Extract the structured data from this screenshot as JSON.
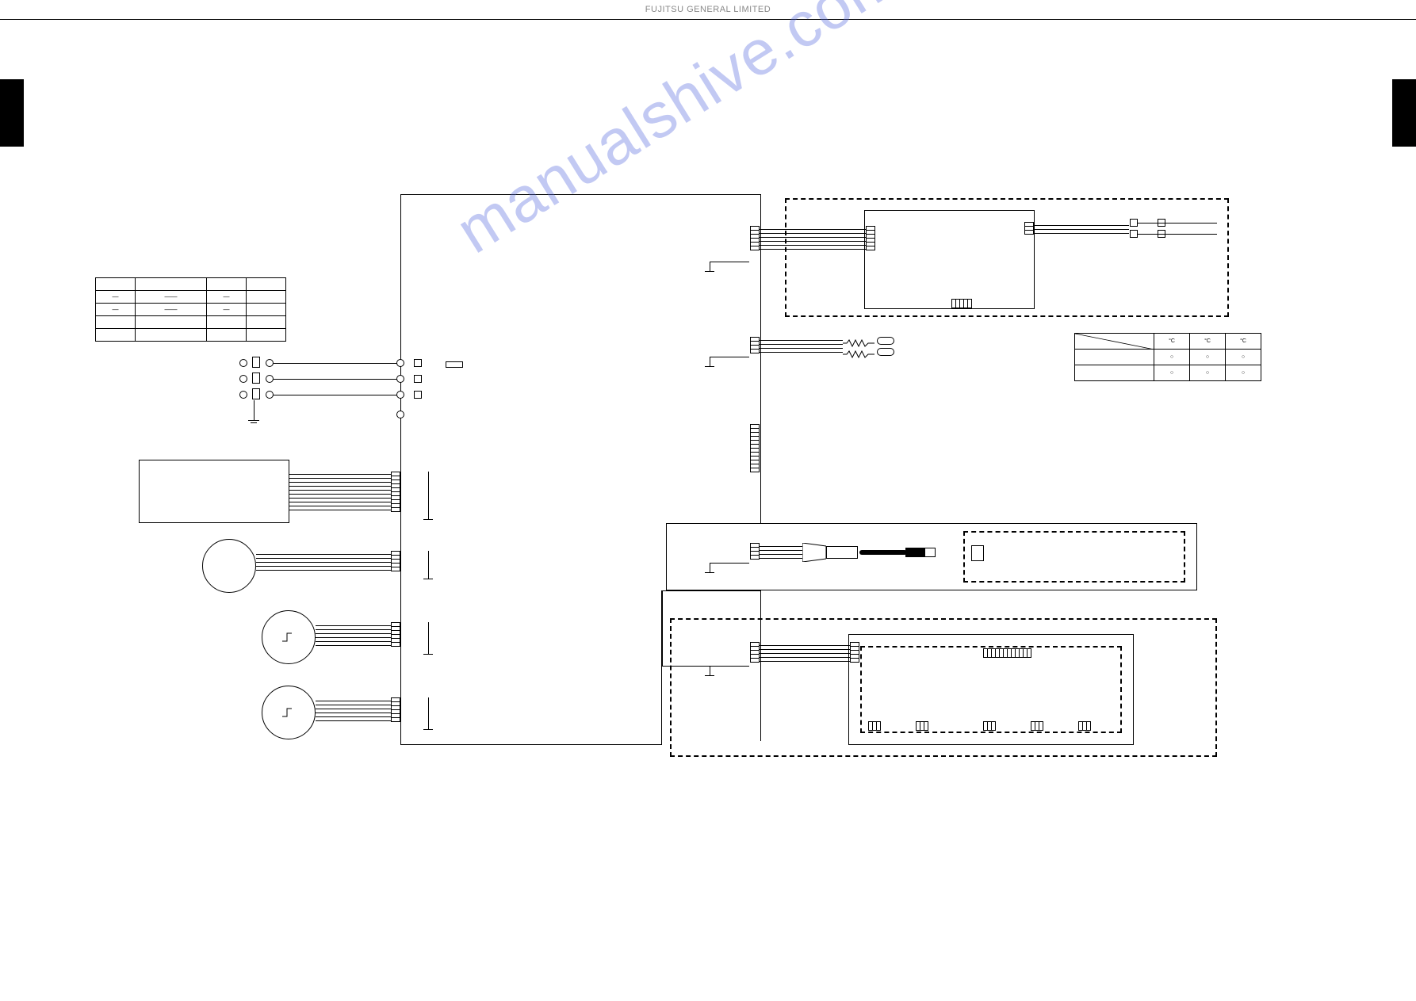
{
  "header": {
    "company": "FUJITSU GENERAL LIMITED"
  },
  "watermark": "manualshive.com",
  "table1": {
    "rows": [
      [
        "",
        "",
        "",
        ""
      ],
      [
        "—",
        "——",
        "—",
        ""
      ],
      [
        "—",
        "——",
        "—",
        ""
      ],
      [
        "",
        "",
        "",
        ""
      ],
      [
        "",
        "",
        "",
        ""
      ]
    ]
  },
  "table2": {
    "header": [
      "",
      "°C",
      "°C",
      "°C"
    ],
    "rows": [
      [
        "",
        "○",
        "○",
        "○"
      ],
      [
        "",
        "○",
        "○",
        "○"
      ]
    ]
  }
}
